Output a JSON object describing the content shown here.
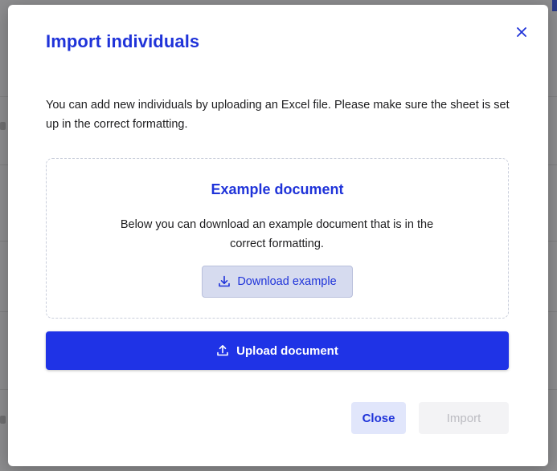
{
  "modal": {
    "title": "Import individuals",
    "close_icon": "close-icon",
    "intro": "You can add new individuals by uploading an Excel file. Please make sure the sheet is set up in the correct formatting.",
    "example": {
      "title": "Example document",
      "description": "Below you can download an example document that is in the correct formatting.",
      "download_label": "Download example",
      "download_icon": "download-icon"
    },
    "upload": {
      "label": "Upload document",
      "icon": "upload-icon"
    },
    "footer": {
      "close_label": "Close",
      "import_label": "Import",
      "import_disabled": true
    }
  },
  "colors": {
    "accent": "#1f33e6",
    "title": "#1f33d9",
    "overlay": "#8d8d8f"
  }
}
